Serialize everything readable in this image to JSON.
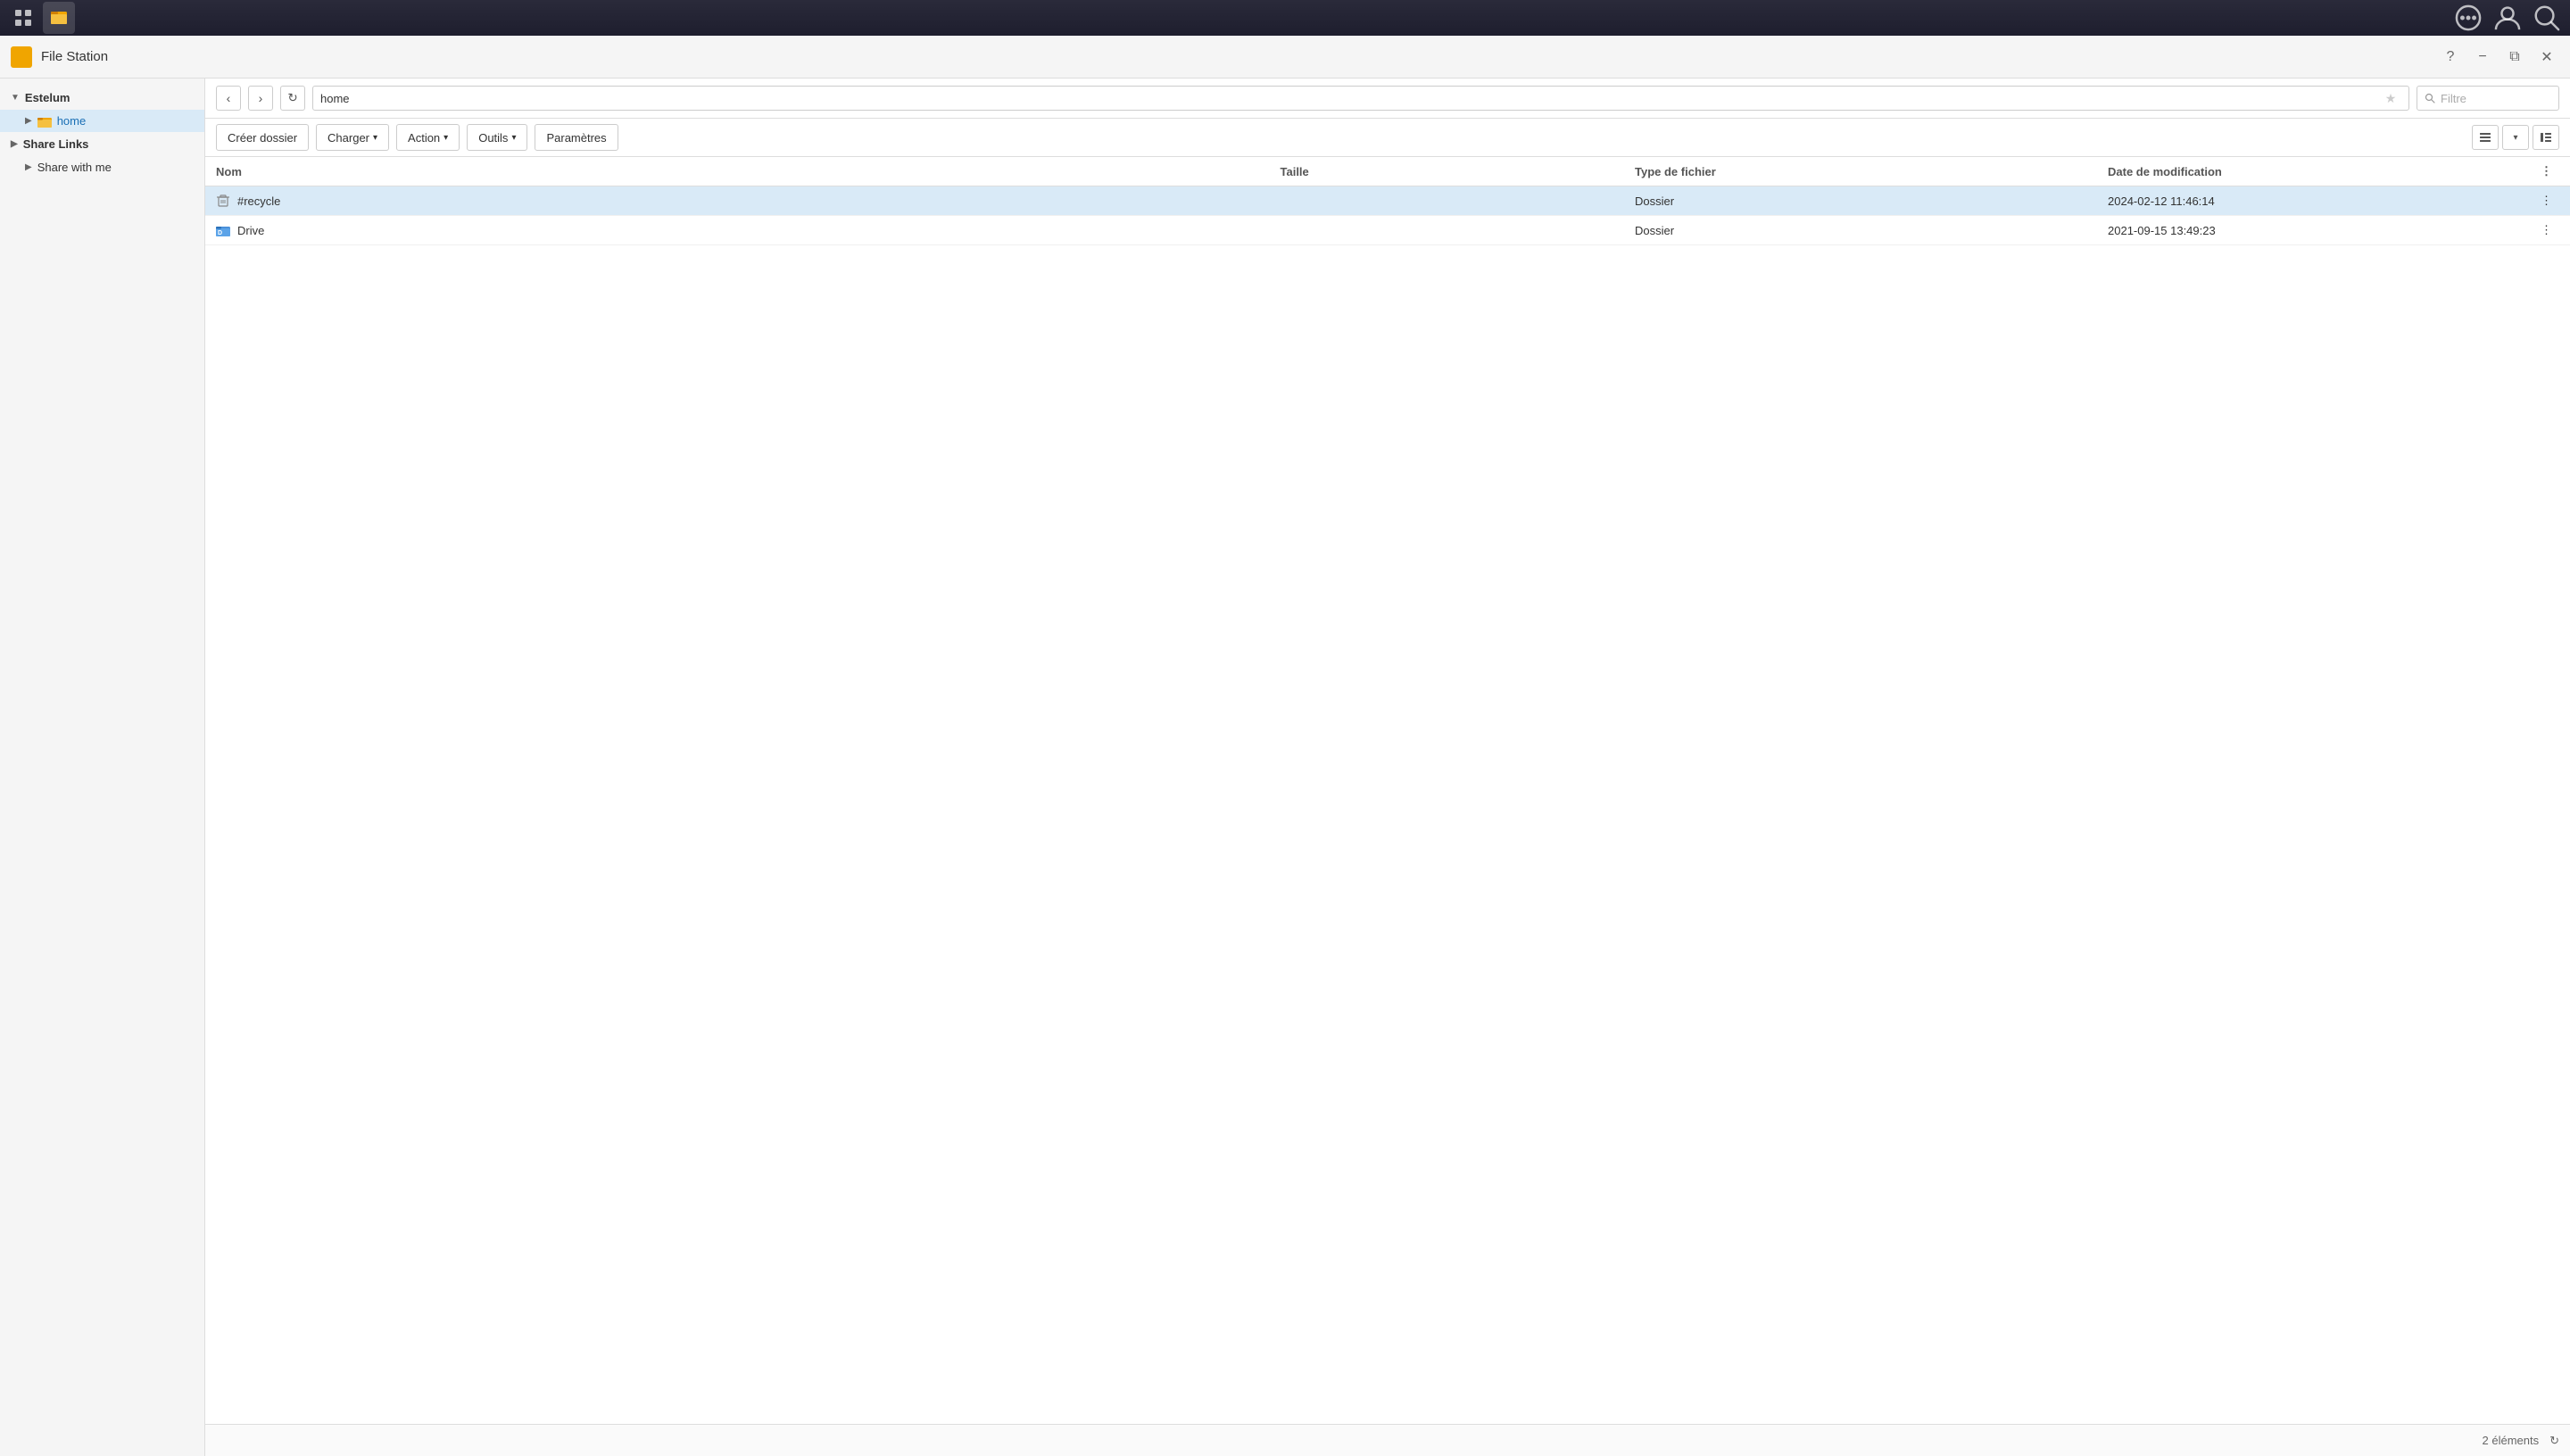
{
  "taskbar": {
    "apps_icon_label": "apps",
    "file_station_icon_label": "file-station"
  },
  "taskbar_right": {
    "chat_icon": "💬",
    "user_icon": "👤",
    "search_icon": "🔍"
  },
  "window": {
    "title": "File Station",
    "help_btn": "?",
    "minimize_btn": "−",
    "restore_btn": "⧉",
    "close_btn": "✕"
  },
  "sidebar": {
    "estelum_label": "Estelum",
    "home_label": "home",
    "share_links_label": "Share Links",
    "share_with_me_label": "Share with me"
  },
  "toolbar": {
    "back_btn": "‹",
    "forward_btn": "›",
    "refresh_btn": "↻",
    "path": "home",
    "star_btn": "★",
    "filter_placeholder": "Filtre"
  },
  "action_toolbar": {
    "create_folder_btn": "Créer dossier",
    "upload_btn": "Charger",
    "upload_dropdown": "▾",
    "action_btn": "Action",
    "action_dropdown": "▾",
    "tools_btn": "Outils",
    "tools_dropdown": "▾",
    "settings_btn": "Paramètres"
  },
  "table": {
    "col_name": "Nom",
    "col_size": "Taille",
    "col_type": "Type de fichier",
    "col_date": "Date de modification",
    "col_more": "⋮",
    "rows": [
      {
        "icon": "trash",
        "name": "#recycle",
        "size": "",
        "type": "Dossier",
        "date": "2024-02-12 11:46:14"
      },
      {
        "icon": "drive",
        "name": "Drive",
        "size": "",
        "type": "Dossier",
        "date": "2021-09-15 13:49:23"
      }
    ]
  },
  "status_bar": {
    "count": "2 éléments",
    "refresh_icon": "↻"
  }
}
